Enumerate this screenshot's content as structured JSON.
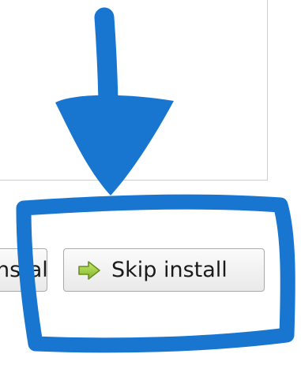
{
  "buttons": {
    "install_label": "Install",
    "skip_label": "Skip install"
  },
  "icons": {
    "skip": "green-arrow-right-icon"
  },
  "colors": {
    "annotation": "#1876d1",
    "arrow_icon": "#8fc43a"
  }
}
